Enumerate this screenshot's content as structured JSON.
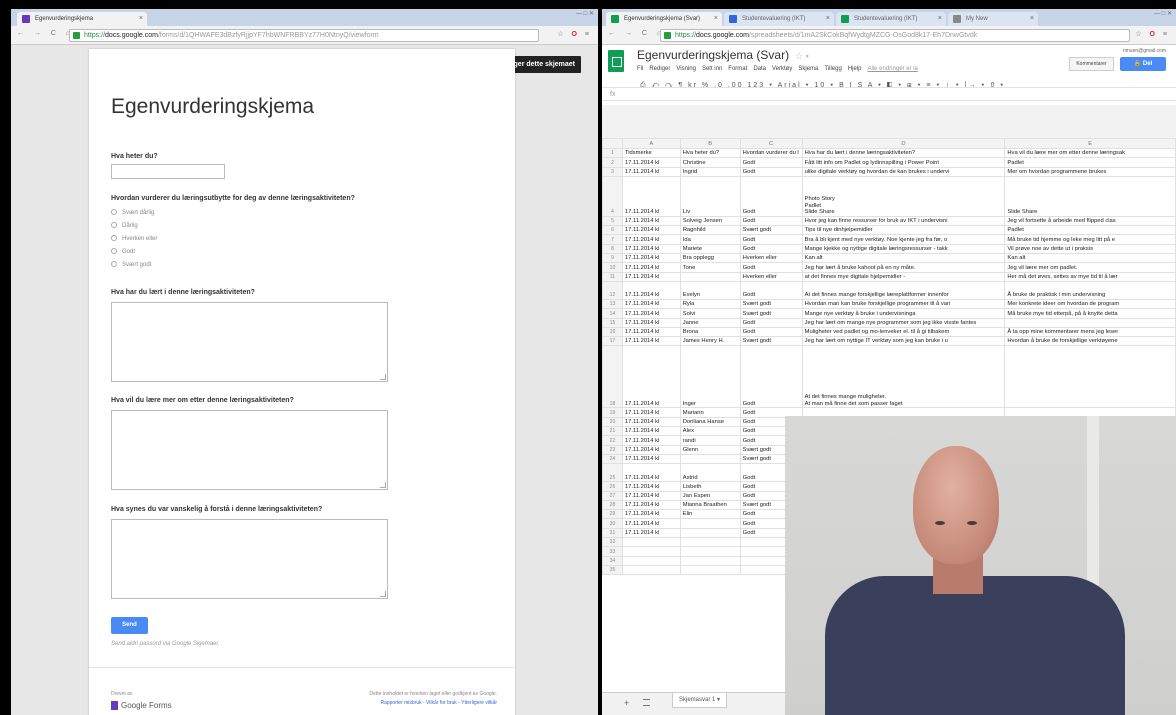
{
  "left_window": {
    "tab_title": "Egenvurderingskjema",
    "url_scheme": "https://",
    "url_host": "docs.google.com",
    "url_path": "/forms/d/1QHWAFE3dBzfyRjjpYF7hbWNFRBBYz77H0NtnyQ/viewform",
    "window_controls": "— □ ✕"
  },
  "form": {
    "edit_button": "✎ Rediger dette skjemaet",
    "title": "Egenvurderingskjema",
    "q_name": "Hva heter du?",
    "q_rating": "Hvordan vurderer du læringsutbytte for deg av denne læringsaktiviteten?",
    "options": [
      "Svært dårlig",
      "Dårlig",
      "Hverken eller",
      "Godt",
      "Svært godt"
    ],
    "q_learned": "Hva har du lært i denne læringsaktiviteten?",
    "q_more": "Hva vil du lære mer om etter denne læringsaktiviteten?",
    "q_hard": "Hva synes du var vanskelig å forstå i denne læringsaktiviteten?",
    "submit": "Send",
    "password_note": "Send aldri passord via Google Skjemaer.",
    "powered_by": "Drevet av",
    "brand": "Google Forms",
    "footer_note": "Dette innholdet er hverken laget eller godkjent av Google.",
    "footer_links": "Rapporter misbruk - Vilkår for bruk - Ytterligere vilkår"
  },
  "right_window": {
    "tabs": [
      "Egenvurderingskjema (Svar)",
      "Studentevaluering (IKT)",
      "Studentevaluering (IKT)",
      "My New"
    ],
    "url_scheme": "https://",
    "url_host": "docs.google.com",
    "url_path": "/spreadsheets/d/1mA2SkCokBqfWydtgMZCG-OsGod8k17-Eh7DnwGtvdk"
  },
  "sheet": {
    "title": "Egenvurderingskjema (Svar)",
    "menu": [
      "Fil",
      "Rediger",
      "Visning",
      "Sett inn",
      "Format",
      "Data",
      "Verktøy",
      "Skjema",
      "Tillegg",
      "Hjelp"
    ],
    "saved_note": "Alle endringer er la",
    "account": "nmuen@gmail.com",
    "comments_button": "Kommentarer",
    "share_button": "🔒 Del",
    "toolbar": "⎙ ↶ ↷ ¶  kr  %  .0 .00 123 ▾  Arial  ▾  10  ▾  B  I  S  A ▾  ◧ ▾  ⊞ ▾  ≡ ▾  ⊥ ▾  |→ ▾  ⇧ ▾",
    "fx": "fx",
    "col_letters": [
      "",
      "A",
      "B",
      "C",
      "D",
      "E"
    ],
    "header_row": [
      "Tidsmerke",
      "Hva heter du?",
      "Hvordan vurderer du l",
      "Hva har du lært i denne læringsaktiviteten?",
      "Hva vil du lære mer om etter denne læringsak"
    ],
    "rows": [
      {
        "n": "2",
        "a": "17.11.2014 kl",
        "b": "Christine",
        "c": "Godt",
        "d": "Fått litt info om Padlet og lydinnspilling i Power Point",
        "e": "Padlet"
      },
      {
        "n": "3",
        "a": "17.11.2014 kl",
        "b": "Ingrid",
        "c": "Godt",
        "d": "ulike digitale verktøy og hvordan de kan brukes i undervi",
        "e": "Mer om hvordan programmene brukes"
      },
      {
        "n": "4",
        "a": "17.11.2014 kl",
        "b": "Liv",
        "c": "Godt",
        "d": "Photo Story\nPadlet\nSlide Share",
        "e": "Slide Share",
        "tall": true
      },
      {
        "n": "5",
        "a": "17.11.2014 kl",
        "b": "Solveig Jensen",
        "c": "Godt",
        "d": "Hvor jeg kan finne ressurser for bruk av IKT i undervisni",
        "e": "Jeg vil fortsette å arbeide med flipped clas"
      },
      {
        "n": "6",
        "a": "17.11.2014 kl",
        "b": "Ragnhild",
        "c": "Svært godt",
        "d": "Tips til nye dinhjelpemidler",
        "e": "Padlet"
      },
      {
        "n": "7",
        "a": "17.11.2014 kl",
        "b": "Ida",
        "c": "Godt",
        "d": "Bra å bli kjent med nye verktøy. Noe kjente jeg fra før, o",
        "e": "Må bruke tid hjemme og leke meg litt på e"
      },
      {
        "n": "8",
        "a": "17.11.2014 kl",
        "b": "Mariete",
        "c": "Godt",
        "d": "Mange kjekke og nyttige digitale læringsressurser - takk",
        "e": "Vil prøve noe av dette ut i praksis"
      },
      {
        "n": "9",
        "a": "17.11.2014 kl",
        "b": "Bra opplegg",
        "c": "Hverken eller",
        "d": "Kan alt",
        "e": "Kan alt"
      },
      {
        "n": "10",
        "a": "17.11.2014 kl",
        "b": "Tone",
        "c": "Godt",
        "d": "Jeg har lært å bruke kahoot på en ny måte.",
        "e": "Jeg vil lære mer om padlet."
      },
      {
        "n": "11",
        "a": "17.11.2014 kl",
        "b": "",
        "c": "Hverken eller",
        "d": "at det finnes mye digitale hjelpemidler -",
        "e": "Her må det øves, settes av mye tid til å lær"
      },
      {
        "n": "12",
        "a": "17.11.2014 kl",
        "b": "Evelyn",
        "c": "Godt",
        "d": "At det finnes mange forskjellige læreplattformer innenfor",
        "e": "Å bruke de praktisk i min undervisning",
        "tall2": true
      },
      {
        "n": "13",
        "a": "17.11.2014 kl",
        "b": "Ryla",
        "c": "Svært godt",
        "d": "Hvordan man kan bruke forskjellige programmer til å vari",
        "e": "Mer konkrete ideer om hvordan de program"
      },
      {
        "n": "14",
        "a": "17.11.2014 kl",
        "b": "Solvi",
        "c": "Svært godt",
        "d": "Mange nye verktøy å bruke i undervisninga",
        "e": "Må bruke mye tid etterpå, på å knytte detta"
      },
      {
        "n": "15",
        "a": "17.11.2014 kl",
        "b": "Janne",
        "c": "Godt",
        "d": "Jeg har lært om mange nye programmer som jeg ikke visste fantes",
        "e": ""
      },
      {
        "n": "16",
        "a": "17.11.2014 kl",
        "b": "Brona",
        "c": "Godt",
        "d": "Muligheter ved padlet og mo-lenveker el. til å gi tilbakem",
        "e": "Å ta opp mine kommentarer mens jeg leser"
      },
      {
        "n": "17",
        "a": "17.11.2014 kl",
        "b": "James Henry H.",
        "c": "Svært godt",
        "d": "Jeg har lært om nyttige IT verktøy som jeg kan bruke i u",
        "e": "Hvordan å bruke de forskjellige verktøyene"
      },
      {
        "n": "18",
        "a": "17.11.2014 kl",
        "b": "Inger",
        "c": "Godt",
        "d": "At det finnes mange muligheter.\nAt man må finne det som passer faget",
        "e": "",
        "tall3": true
      },
      {
        "n": "19",
        "a": "17.11.2014 kl",
        "b": "Mariann",
        "c": "Godt",
        "d": "",
        "e": ""
      },
      {
        "n": "20",
        "a": "17.11.2014 kl",
        "b": "Doriliana Hanse",
        "c": "Godt",
        "d": "",
        "e": ""
      },
      {
        "n": "21",
        "a": "17.11.2014 kl",
        "b": "Alex",
        "c": "Godt",
        "d": "",
        "e": ""
      },
      {
        "n": "22",
        "a": "17.11.2014 kl",
        "b": "randi",
        "c": "Godt",
        "d": "",
        "e": ""
      },
      {
        "n": "23",
        "a": "17.11.2014 kl",
        "b": "Glenn",
        "c": "Svært godt",
        "d": "",
        "e": ""
      },
      {
        "n": "24",
        "a": "17.11.2014 kl",
        "b": "",
        "c": "Svært godt",
        "d": "",
        "e": ""
      },
      {
        "n": "25",
        "a": "17.11.2014 kl",
        "b": "Astrid",
        "c": "Godt",
        "d": "",
        "e": "",
        "tall2": true
      },
      {
        "n": "26",
        "a": "17.11.2014 kl",
        "b": "Lisbeth",
        "c": "Godt",
        "d": "",
        "e": ""
      },
      {
        "n": "27",
        "a": "17.11.2014 kl",
        "b": "Jan Espen",
        "c": "Godt",
        "d": "",
        "e": ""
      },
      {
        "n": "28",
        "a": "17.11.2014 kl",
        "b": "Mianna Braathen",
        "c": "Svært godt",
        "d": "",
        "e": ""
      },
      {
        "n": "29",
        "a": "17.11.2014 kl",
        "b": "Elin",
        "c": "Godt",
        "d": "",
        "e": ""
      },
      {
        "n": "30",
        "a": "17.11.2014 kl",
        "b": "",
        "c": "Godt",
        "d": "",
        "e": ""
      },
      {
        "n": "31",
        "a": "17.11.2014 kl",
        "b": "",
        "c": "Godt",
        "d": "",
        "e": ""
      },
      {
        "n": "32",
        "a": "",
        "b": "",
        "c": "",
        "d": "",
        "e": ""
      },
      {
        "n": "33",
        "a": "",
        "b": "",
        "c": "",
        "d": "",
        "e": ""
      },
      {
        "n": "34",
        "a": "",
        "b": "",
        "c": "",
        "d": "",
        "e": ""
      },
      {
        "n": "35",
        "a": "",
        "b": "",
        "c": "",
        "d": "",
        "e": ""
      }
    ],
    "sheet_tab": "Skjemasvar 1 ▾",
    "add_sheet": "+"
  },
  "colors": {
    "sheets_green": "#0f9d58",
    "share_blue": "#4a8af4",
    "forms_purple": "#673ab7"
  }
}
